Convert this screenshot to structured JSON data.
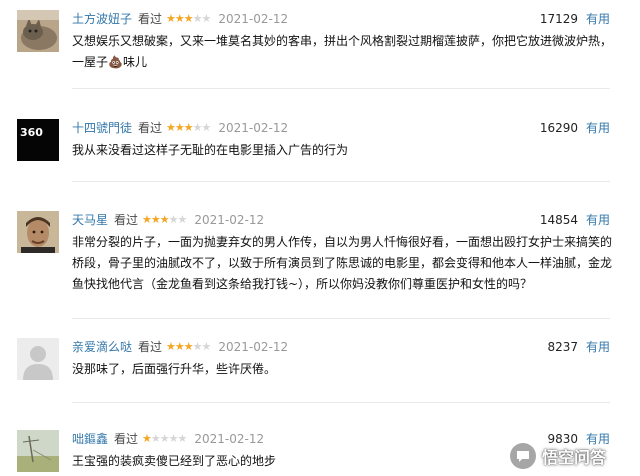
{
  "reviews": [
    {
      "username": "土方波妞子",
      "status": "看过",
      "rating": 3,
      "date": "2021-02-12",
      "votes": "17129",
      "useful_label": "有用",
      "comment": "又想娱乐又想破案，又来一堆莫名其妙的客串，拼出个风格割裂过期榴莲披萨，你把它放进微波炉热，一屋子💩味儿",
      "avatar": "cat-photo"
    },
    {
      "username": "十四號門徒",
      "status": "看过",
      "rating": 3,
      "date": "2021-02-12",
      "votes": "16290",
      "useful_label": "有用",
      "comment": "我从来没看过这样子无耻的在电影里插入广告的行为",
      "avatar": "black-square-360",
      "avatar_text": "360"
    },
    {
      "username": "天马星",
      "status": "看过",
      "rating": 3,
      "date": "2021-02-12",
      "votes": "14854",
      "useful_label": "有用",
      "comment": "非常分裂的片子，一面为抛妻弃女的男人作传，自以为男人忏悔很好看，一面想出殴打女护士来搞笑的桥段，骨子里的油腻改不了，以致于所有演员到了陈思诚的电影里，都会变得和他本人一样油腻，金龙鱼快找他代言（金龙鱼看到这条给我打钱~），所以你妈没教你们尊重医护和女性的吗？",
      "avatar": "man-portrait"
    },
    {
      "username": "亲爱滴么哒",
      "status": "看过",
      "rating": 3,
      "date": "2021-02-12",
      "votes": "8237",
      "useful_label": "有用",
      "comment": "没那味了，后面强行升华，些许厌倦。",
      "avatar": "default-avatar"
    },
    {
      "username": "咄鏂鑫",
      "status": "看过",
      "rating": 1,
      "date": "2021-02-12",
      "votes": "9830",
      "useful_label": "有用",
      "comment": "王宝强的装疯卖傻已经到了恶心的地步",
      "avatar": "landscape-photo"
    }
  ],
  "watermark": {
    "text": "悟空问答",
    "icon": "chat-bubble-icon"
  },
  "colors": {
    "link": "#3377aa",
    "star": "#f5a623",
    "star_empty": "#d6d6d6",
    "date": "#999999"
  }
}
